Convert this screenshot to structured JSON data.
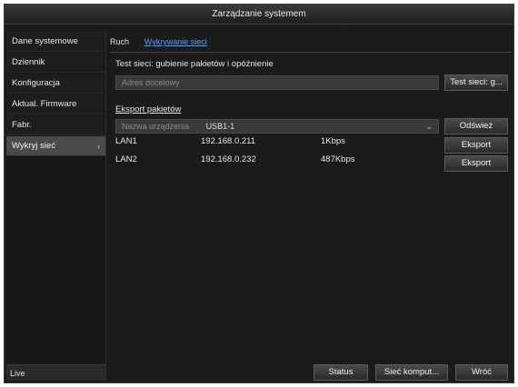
{
  "window": {
    "title": "Zarządzanie systemem"
  },
  "sidebar": {
    "items": [
      {
        "label": "Dane systemowe"
      },
      {
        "label": "Dziennik"
      },
      {
        "label": "Konfiguracja"
      },
      {
        "label": "Aktual. Firmware"
      },
      {
        "label": "Fabr."
      },
      {
        "label": "Wykryj sieć",
        "chevron": "›",
        "active": true
      }
    ],
    "live_label": "Live"
  },
  "tabs": [
    {
      "label": "Ruch"
    },
    {
      "label": "Wykrywanie sieci",
      "active": true
    }
  ],
  "test": {
    "title": "Test sieci: gubienie pakietów i opóźnienie",
    "target_placeholder": "Adres docelowy",
    "button_label": "Test sieci: g..."
  },
  "export": {
    "title": "Eksport pakietów",
    "device_label": "Nazwa urządzenia",
    "device_value": "USB1-1",
    "refresh_label": "Odśwież",
    "rows": [
      {
        "name": "LAN1",
        "ip": "192.168.0.211",
        "rate": "1Kbps",
        "button": "Eksport"
      },
      {
        "name": "LAN2",
        "ip": "192.168.0.232",
        "rate": "487Kbps",
        "button": "Eksport"
      }
    ]
  },
  "footer": {
    "status_label": "Status",
    "network_label": "Sieć komput...",
    "back_label": "Wróć"
  }
}
